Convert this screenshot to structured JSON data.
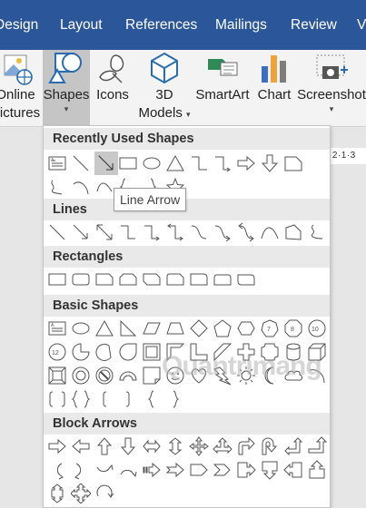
{
  "tabs": [
    "Design",
    "Layout",
    "References",
    "Mailings",
    "Review",
    "V"
  ],
  "ribbon": {
    "online_pictures": [
      "Online",
      "Pictures"
    ],
    "shapes": "Shapes",
    "icons": "Icons",
    "models": [
      "3D",
      "Models"
    ],
    "smartart": "SmartArt",
    "chart": "Chart",
    "screenshot": "Screenshot"
  },
  "ruler_text": "·2·1·3",
  "sections": {
    "recent": "Recently Used Shapes",
    "lines": "Lines",
    "rectangles": "Rectangles",
    "basic": "Basic Shapes",
    "block": "Block Arrows"
  },
  "tooltip": "Line Arrow",
  "watermark": "Quantrimang",
  "colors": {
    "tab_bar": "#2b579a",
    "selected_shape": "#c8c8c8"
  }
}
